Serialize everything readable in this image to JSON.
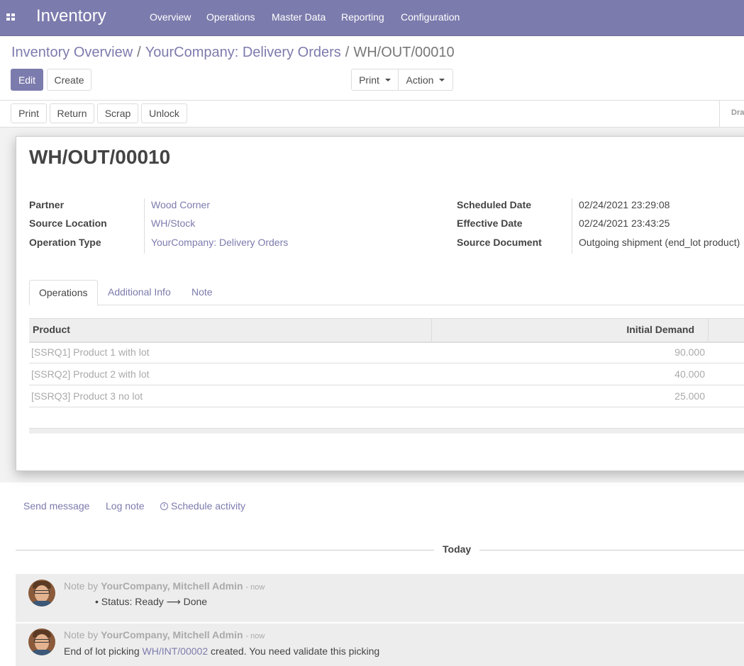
{
  "navbar": {
    "app_title": "Inventory",
    "menu": [
      "Overview",
      "Operations",
      "Master Data",
      "Reporting",
      "Configuration"
    ],
    "color": "#7c7bad"
  },
  "breadcrumb": {
    "items": [
      "Inventory Overview",
      "YourCompany: Delivery Orders"
    ],
    "current": "WH/OUT/00010",
    "separator": "/"
  },
  "buttons": {
    "edit": "Edit",
    "create": "Create",
    "print_dropdown": "Print",
    "action_dropdown": "Action"
  },
  "statusbar": {
    "buttons": [
      "Print",
      "Return",
      "Scrap",
      "Unlock"
    ],
    "state_partial": "Dra"
  },
  "record": {
    "name": "WH/OUT/00010",
    "left_fields": [
      {
        "label": "Partner",
        "value": "Wood Corner"
      },
      {
        "label": "Source Location",
        "value": "WH/Stock"
      },
      {
        "label": "Operation Type",
        "value": "YourCompany: Delivery Orders"
      }
    ],
    "right_fields": [
      {
        "label": "Scheduled Date",
        "value": "02/24/2021 23:29:08"
      },
      {
        "label": "Effective Date",
        "value": "02/24/2021 23:43:25"
      },
      {
        "label": "Source Document",
        "value": "Outgoing shipment (end_lot product)"
      }
    ]
  },
  "tabs": [
    "Operations",
    "Additional Info",
    "Note"
  ],
  "table": {
    "headers": [
      "Product",
      "Initial Demand"
    ],
    "rows": [
      {
        "product": "[SSRQ1] Product 1 with lot",
        "qty": "90.000"
      },
      {
        "product": "[SSRQ2] Product 2 with lot",
        "qty": "40.000"
      },
      {
        "product": "[SSRQ3] Product 3 no lot",
        "qty": "25.000"
      }
    ]
  },
  "chatter": {
    "send_message": "Send message",
    "log_note": "Log note",
    "schedule_activity": "Schedule activity",
    "date_separator": "Today",
    "messages": [
      {
        "prefix": "Note by",
        "author": "YourCompany, Mitchell Admin",
        "time": "- now",
        "bullet": "Status: Ready",
        "bullet_arrow": "⟶",
        "bullet_new": "Done"
      },
      {
        "prefix": "Note by",
        "author": "YourCompany, Mitchell Admin",
        "time": "- now",
        "body_before": "End of lot picking",
        "body_link": "WH/INT/00002",
        "body_after": "created. You need validate this picking"
      }
    ]
  }
}
